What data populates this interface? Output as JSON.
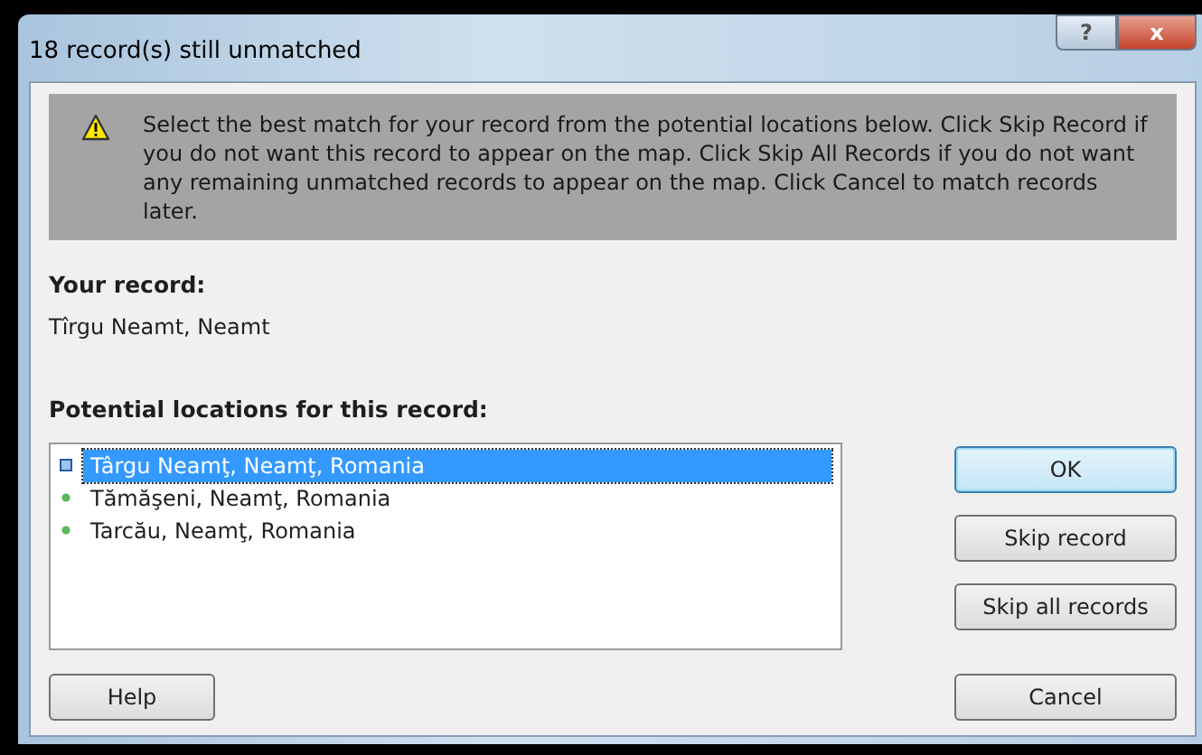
{
  "window": {
    "title": "18 record(s) still unmatched",
    "title_buttons": [
      "?",
      "x"
    ]
  },
  "banner": {
    "message": "Select the best match for your record from the potential locations below. Click Skip Record if you do not want this record to appear on the map. Click Skip All Records if you do not want any remaining unmatched records to appear on the map. Click Cancel to match records later."
  },
  "record": {
    "label": "Your record:",
    "value": "Tîrgu Neamt, Neamt"
  },
  "locations": {
    "label": "Potential locations for this record:",
    "items": [
      {
        "text": "Târgu Neamţ, Neamţ, Romania",
        "selected": true
      },
      {
        "text": "Tămăşeni, Neamţ, Romania",
        "selected": false
      },
      {
        "text": "Tarcău, Neamţ, Romania",
        "selected": false
      }
    ]
  },
  "buttons": [
    {
      "label": "OK",
      "default": true
    },
    {
      "label": "Skip record",
      "default": false
    },
    {
      "label": "Skip all records",
      "default": false
    }
  ],
  "footer": {
    "help": "Help",
    "cancel": "Cancel"
  }
}
